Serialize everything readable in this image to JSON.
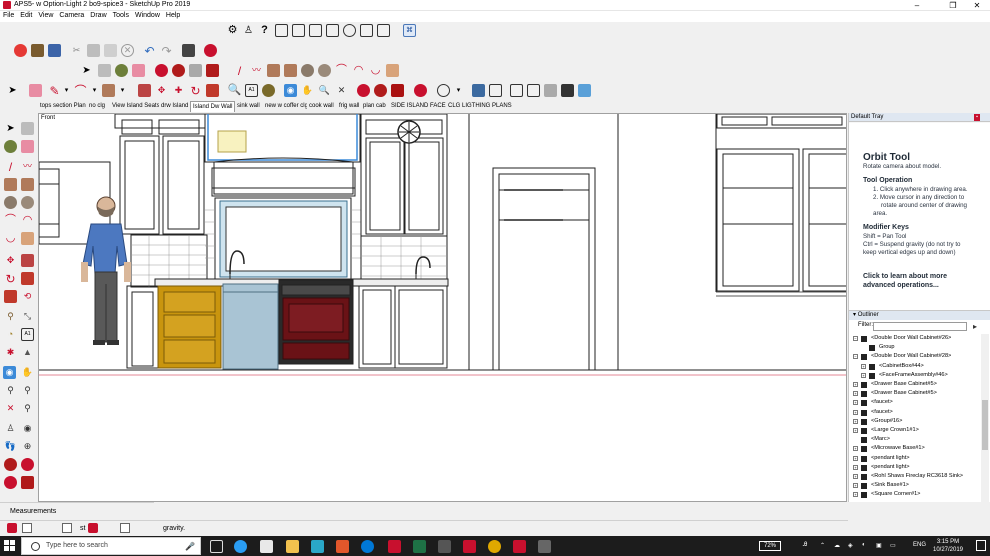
{
  "window": {
    "title": "APS5- w Option-Light 2 bo9-spice3 - SketchUp Pro 2019",
    "min": "–",
    "max": "❐",
    "close": "✕"
  },
  "menu": [
    "File",
    "Edit",
    "View",
    "Camera",
    "Draw",
    "Tools",
    "Window",
    "Help"
  ],
  "scenes": [
    {
      "label": "tops section Plan",
      "active": false
    },
    {
      "label": "no clg",
      "active": false
    },
    {
      "label": "View Island Seats",
      "active": false
    },
    {
      "label": "drw Island",
      "active": false
    },
    {
      "label": "Island Dw Wall",
      "active": true
    },
    {
      "label": "sink wall",
      "active": false
    },
    {
      "label": "new w coffer clg",
      "active": false
    },
    {
      "label": "cook wall",
      "active": false
    },
    {
      "label": "frig wall",
      "active": false
    },
    {
      "label": "plan cab",
      "active": false
    },
    {
      "label": "SIDE ISLAND FACE",
      "active": false
    },
    {
      "label": "CLG  LIGTHING PLANS",
      "active": false
    }
  ],
  "viewport": {
    "label": "Front"
  },
  "tray": {
    "title": "Default Tray",
    "instructor": {
      "tool_name": "Orbit Tool",
      "tool_desc": "Rotate camera about model.",
      "operation_head": "Tool Operation",
      "operation_lines": [
        "1. Click anywhere in drawing area.",
        "2. Move cursor in any direction to",
        "rotate around center of drawing",
        "area."
      ],
      "modifier_head": "Modifier Keys",
      "modifier_lines": [
        "Shift = Pan Tool",
        "Ctrl = Suspend gravity (do not try to",
        "keep vertical edges up and down)"
      ],
      "more_link": [
        "Click to learn about more",
        "advanced operations..."
      ]
    },
    "outliner": {
      "title": "Outliner",
      "filter_label": "Filter:",
      "filter_value": "",
      "items": [
        {
          "label": "<Double Door Wall Cabinet#26>",
          "indent": 0,
          "expanded": true
        },
        {
          "label": "Group",
          "indent": 1,
          "expanded": null
        },
        {
          "label": "<Double Door Wall Cabinet#28>",
          "indent": 0,
          "expanded": true
        },
        {
          "label": "<CabinetBox#44>",
          "indent": 1,
          "expanded": false
        },
        {
          "label": "<FaceFrameAssembly#46>",
          "indent": 1,
          "expanded": false
        },
        {
          "label": "<Drawer Base Cabinet#5>",
          "indent": 0,
          "expanded": false
        },
        {
          "label": "<Drawer Base Cabinet#5>",
          "indent": 0,
          "expanded": false
        },
        {
          "label": "<faucet>",
          "indent": 0,
          "expanded": false
        },
        {
          "label": "<faucet>",
          "indent": 0,
          "expanded": false
        },
        {
          "label": "<Group#16>",
          "indent": 0,
          "expanded": false
        },
        {
          "label": "<Large Crown1#1>",
          "indent": 0,
          "expanded": false
        },
        {
          "label": "<Marc>",
          "indent": 0,
          "expanded": null
        },
        {
          "label": "<Microwave Base#1>",
          "indent": 0,
          "expanded": false
        },
        {
          "label": "<pendant light>",
          "indent": 0,
          "expanded": false
        },
        {
          "label": "<pendant light>",
          "indent": 0,
          "expanded": false
        },
        {
          "label": "<Rohl Shaws Fireclay RC3618 Sink>",
          "indent": 0,
          "expanded": false
        },
        {
          "label": "<Sink Base#1>",
          "indent": 0,
          "expanded": false
        },
        {
          "label": "<Square Corner#1>",
          "indent": 0,
          "expanded": false
        }
      ]
    }
  },
  "measurements": {
    "label": "Measurements",
    "value": ""
  },
  "status": {
    "text": "gravity.",
    "cut_text": "st"
  },
  "taskbar": {
    "search_placeholder": "Type here to search",
    "battery": "72%",
    "lang": "ENG",
    "time": "3:15 PM",
    "date": "10/27/2019"
  },
  "colors": {
    "accent_red": "#c8102e",
    "selection_blue": "#3c8ad8",
    "cabinet_yellow": "#c9950e",
    "range_maroon": "#6a1216",
    "dishwasher_blue": "#a9c4d4"
  }
}
